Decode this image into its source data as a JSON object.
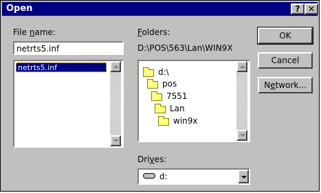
{
  "window": {
    "title": "Open",
    "help_glyph": "?",
    "close_glyph": "✕"
  },
  "file_name": {
    "label": {
      "pre": "File ",
      "key": "n",
      "post": "ame:"
    },
    "value": "netrts5.inf",
    "list_items": [
      "netrts5.inf"
    ]
  },
  "folders": {
    "label": {
      "key": "F",
      "post": "olders:"
    },
    "current_path": "D:\\POS\\563\\Lan\\WIN9X",
    "tree": [
      "d:\\",
      "pos",
      "7551",
      "Lan",
      "win9x"
    ]
  },
  "drives": {
    "label": {
      "pre": "Dri",
      "key": "v",
      "post": "es:"
    },
    "selected": "d:"
  },
  "buttons": {
    "ok": "OK",
    "cancel": "Cancel",
    "network": {
      "pre": "N",
      "key": "e",
      "post": "twork..."
    }
  },
  "colors": {
    "title_bar": "#000080",
    "face": "#c0c0c0",
    "selection": "#000080"
  }
}
